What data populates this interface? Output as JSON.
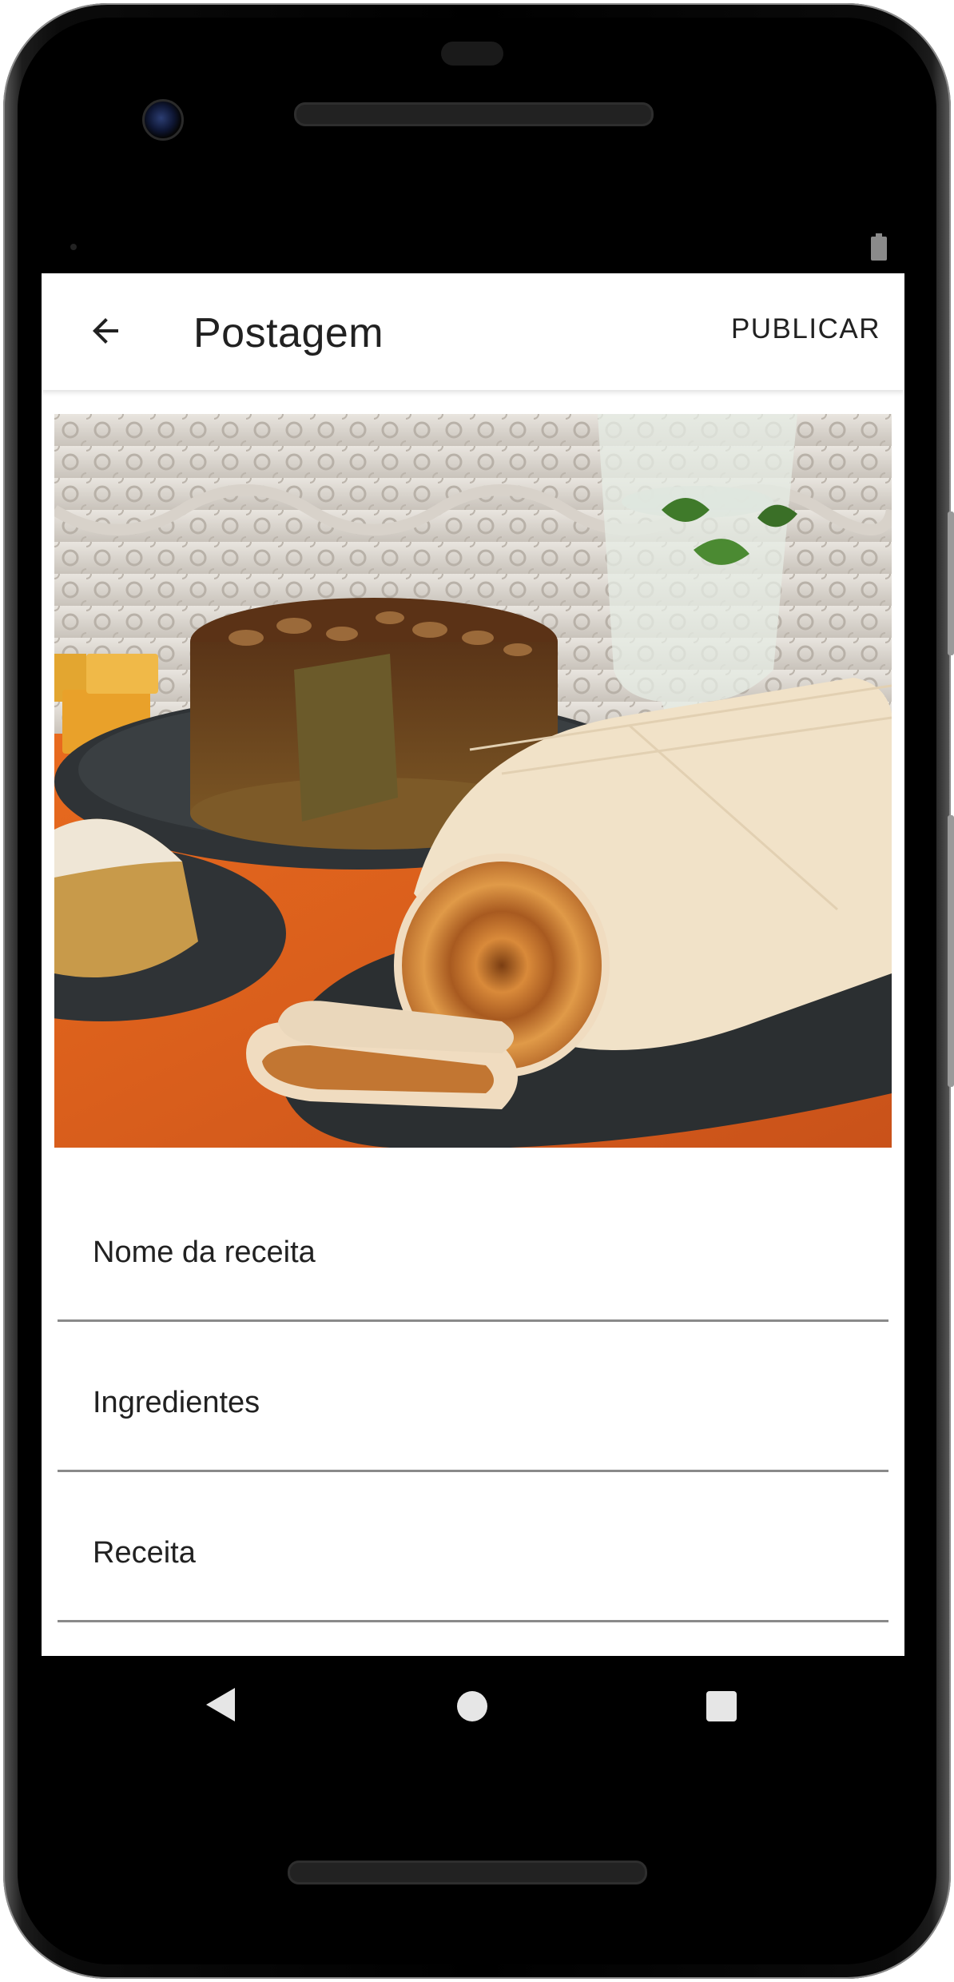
{
  "app_bar": {
    "title": "Postagem",
    "publish_label": "PUBLICAR",
    "back_icon": "arrow-left-icon"
  },
  "photo": {
    "subject": "food-photo",
    "palette": [
      "#7a3d17",
      "#d9641f",
      "#f1dfc4",
      "#2f3336",
      "#e6e2dc"
    ]
  },
  "form": {
    "fields": [
      {
        "placeholder": "Nome da receita",
        "value": ""
      },
      {
        "placeholder": "Ingredientes",
        "value": ""
      },
      {
        "placeholder": "Receita",
        "value": ""
      }
    ]
  },
  "system": {
    "nav": [
      "back-triangle-icon",
      "home-circle-icon",
      "recents-square-icon"
    ],
    "status_icons": [
      "battery-icon"
    ]
  },
  "colors": {
    "text_primary": "#212121",
    "underline": "#8a8a8a",
    "screen_bg": "#ffffff",
    "device": "#000000"
  }
}
